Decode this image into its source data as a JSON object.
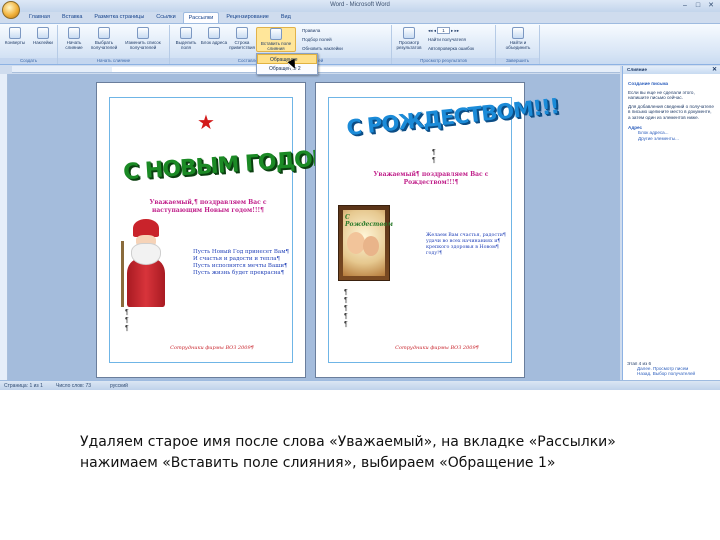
{
  "window": {
    "title": "Word - Microsoft Word"
  },
  "ribbon": {
    "tabs": [
      "Главная",
      "Вставка",
      "Разметка страницы",
      "Ссылки",
      "Рассылки",
      "Рецензирование",
      "Вид"
    ],
    "active_tab": "Рассылки",
    "buttons": {
      "envelopes": "Конверты",
      "labels": "Наклейки",
      "start_merge": "Начать слияние",
      "select_recipients": "Выбрать получателей",
      "edit_list": "Изменить список получателей",
      "highlight_fields": "Выделить поля",
      "address_block": "Блок адреса",
      "greeting_line": "Строка приветствия",
      "insert_merge_field": "Вставить поле слияния",
      "rules": "Правила",
      "match_fields": "Подбор полей",
      "update_labels": "Обновить наклейки",
      "preview_results": "Просмотр результатов",
      "find_recipient": "Найти получателя",
      "auto_check": "Автопроверка ошибок",
      "finish_merge": "Найти и объединить"
    },
    "groups": {
      "create": "Создать",
      "start": "Начать слияние",
      "write_insert": "Составление документа и вставка полей",
      "preview": "Просмотр результатов",
      "finish": "Завершить"
    },
    "record_number": "1"
  },
  "dropdown": {
    "items": [
      "Обращение",
      "Обращение 2"
    ]
  },
  "document": {
    "left_page": {
      "title_art": "С НОВЫМ ГОДОМ",
      "greeting": "Уважаемый,¶ поздравляем Вас с наступающим Новым годом!!!¶",
      "wishes": [
        "Пусть Новый Год принесет Вам¶",
        "И счастья и радости и тепла¶",
        "Пусть исполнятся мечты Ваши¶",
        "Пусть жизнь будет прекрасна¶"
      ],
      "footer": "Сотрудники фирмы ВОЗ 2009¶"
    },
    "right_page": {
      "title_art": "С РОЖДЕСТВОМ!!!",
      "greeting": "Уважаемый¶ поздравляем Вас с Рождеством!!!¶",
      "card_caption": "С Рождеством",
      "wishes": [
        "Желаем Вам счастья, радости¶",
        "удачи во всех начинаниях и¶",
        "крепкого здоровья в Новом¶",
        "году!¶"
      ],
      "footer": "Сотрудники фирмы ВОЗ 2009¶"
    }
  },
  "taskpane": {
    "title": "Слияние",
    "heading": "Создание письма",
    "text1": "Если вы еще не сделали этого, напишите письмо сейчас.",
    "text2": "Для добавления сведений о получателе в письмо щелкните место в документе, а затем один из элементов ниже.",
    "section": "Адрес",
    "link1": "Блок адреса...",
    "link2": "Другие элементы...",
    "bottom1": "Этап 4 из 6",
    "link3": "Далее. Просмотр писем",
    "link4": "Назад. Выбор получателей"
  },
  "statusbar": {
    "page": "Страница: 1 из 1",
    "words": "Число слов: 73",
    "lang": "русский"
  },
  "caption": {
    "line1": "Удаляем старое имя после слова «Уважаемый», на вкладке «Рассылки»",
    "line2": "нажимаем «Вставить поле слияния», выбираем «Обращение 1»"
  },
  "colors": {
    "accent": "#15428b",
    "ribbon_bg": "#d9e6f6",
    "workspace": "#a4bcdc",
    "highlight": "#ffe08a"
  }
}
